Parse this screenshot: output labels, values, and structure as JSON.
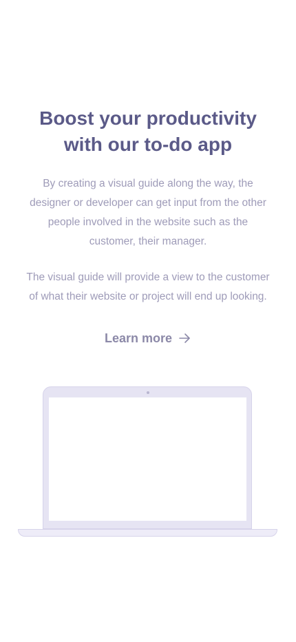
{
  "hero": {
    "title_lines": [
      "Boost your productivity",
      "with our to-do app"
    ],
    "paragraph1_lines": [
      "By creating a visual guide along the way, the",
      "designer or developer can get input from the other",
      "people involved in the website such as the",
      "customer, their manager."
    ],
    "paragraph2_lines": [
      "The visual guide will provide a view to the customer",
      "of what their website or project will end up looking."
    ],
    "cta": {
      "label": "Learn more",
      "icon": "arrow-right-icon"
    }
  },
  "illustration": {
    "device": "laptop",
    "icon": "laptop-illustration"
  },
  "colors": {
    "title": "#5b5a88",
    "text": "#9e9bb8",
    "cta": "#8c89a8",
    "laptop_frame": "#e6e4f3",
    "laptop_border": "#d6d3ea",
    "background": "#ffffff"
  }
}
